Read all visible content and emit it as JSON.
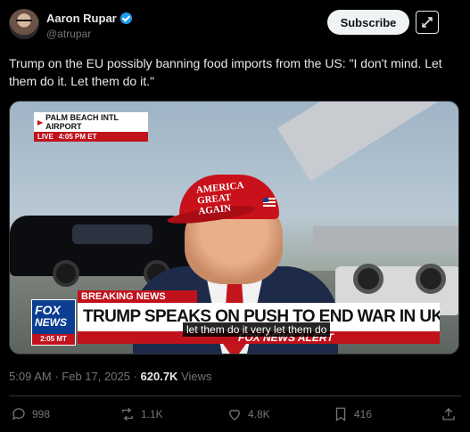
{
  "author": {
    "name": "Aaron Rupar",
    "handle": "@atrupar",
    "verified": true
  },
  "header": {
    "subscribe_label": "Subscribe",
    "grok_icon": "grok-icon"
  },
  "tweet": {
    "text": "Trump on the EU possibly banning food imports from the US: \"I don't mind. Let them do it. Let them do it.\""
  },
  "video": {
    "location_label": "PALM BEACH INTL AIRPORT",
    "live_label": "LIVE",
    "live_time": "4:05 PM ET",
    "hat_text": "AMERICA GREAT AGAIN",
    "breaking_label": "BREAKING NEWS",
    "headline": "TRUMP SPEAKS ON PUSH TO END WAR IN UKRAINE",
    "fox_line1": "FOX",
    "fox_line2": "NEWS",
    "fox_time": "2:05 MT",
    "alert_label": "FOX NEWS ALERT",
    "caption": "let them do it very let them do"
  },
  "meta": {
    "time": "5:09 AM",
    "separator": "·",
    "date": "Feb 17, 2025",
    "views_count": "620.7K",
    "views_label": "Views"
  },
  "actions": {
    "replies": "998",
    "reposts": "1.1K",
    "likes": "4.8K",
    "bookmarks": "416"
  },
  "colors": {
    "background": "#000000",
    "accent": "#1d9bf0",
    "fox_red": "#c1121c",
    "fox_blue": "#0b3d91"
  }
}
